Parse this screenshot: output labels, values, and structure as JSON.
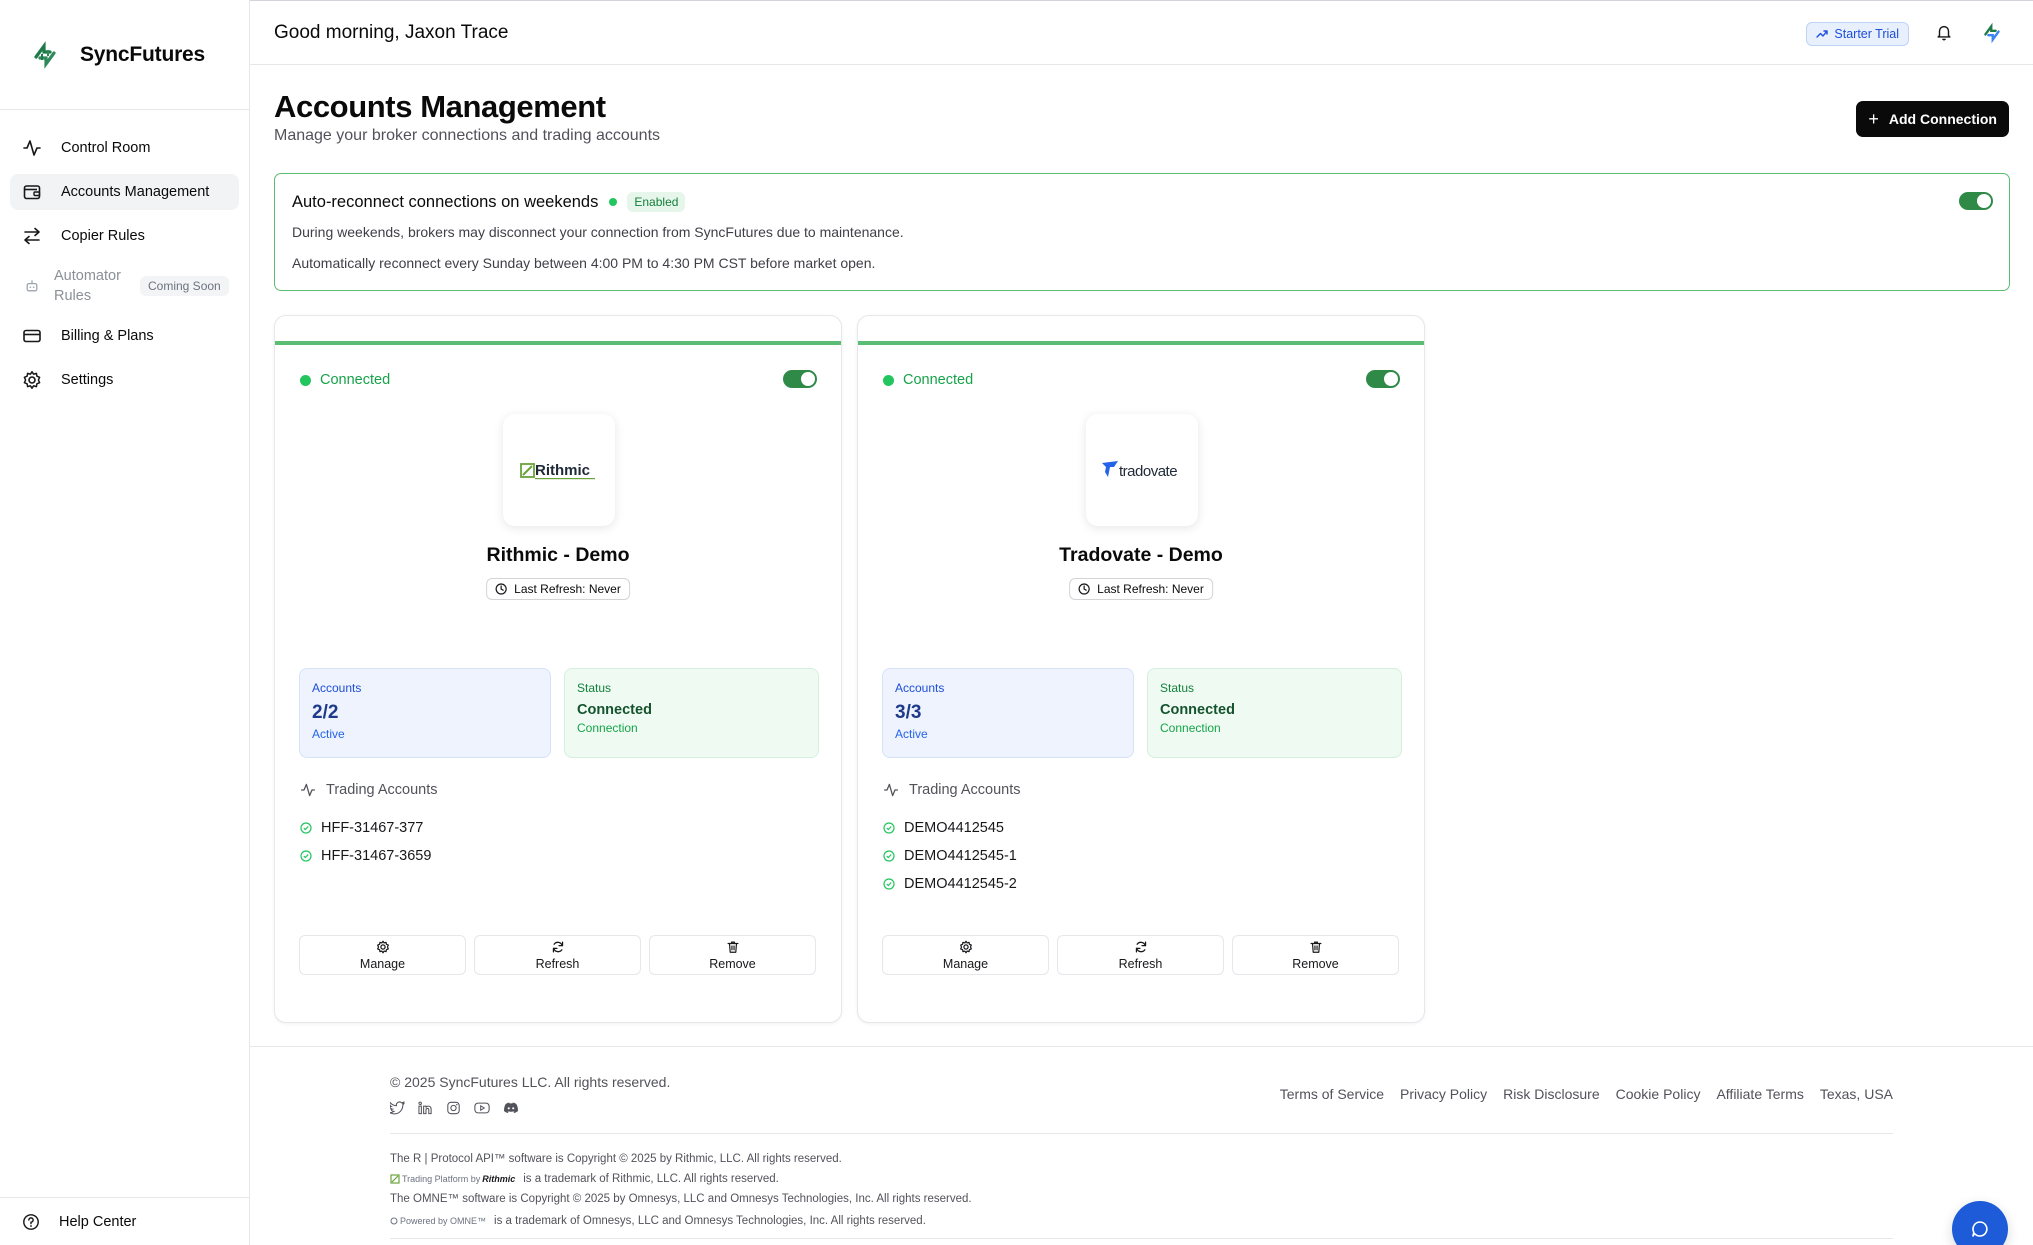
{
  "app": {
    "name": "SyncFutures"
  },
  "header": {
    "greeting": "Good morning, Jaxon Trace",
    "plan_badge": "Starter Trial"
  },
  "sidebar": {
    "items": [
      {
        "label": "Control Room",
        "icon": "activity-icon"
      },
      {
        "label": "Accounts Management",
        "icon": "wallet-icon",
        "active": true
      },
      {
        "label": "Copier Rules",
        "icon": "arrows-swap-icon"
      },
      {
        "label": "Automator Rules",
        "icon": "bot-icon",
        "badge": "Coming Soon",
        "disabled": true
      },
      {
        "label": "Billing & Plans",
        "icon": "credit-card-icon"
      },
      {
        "label": "Settings",
        "icon": "gear-icon"
      }
    ],
    "help": "Help Center"
  },
  "page": {
    "title": "Accounts Management",
    "subtitle": "Manage your broker connections and trading accounts",
    "add_button": "Add Connection"
  },
  "auto_reconnect": {
    "title": "Auto-reconnect connections on weekends",
    "badge": "Enabled",
    "line1": "During weekends, brokers may disconnect your connection from SyncFutures due to maintenance.",
    "line2": "Automatically reconnect every Sunday between 4:00 PM to 4:30 PM CST before market open.",
    "enabled": true
  },
  "connections": [
    {
      "status": "Connected",
      "logo_text": "Rithmic",
      "name": "Rithmic - Demo",
      "last_refresh": "Last Refresh: Never",
      "accounts_label": "Accounts",
      "accounts_value": "2/2",
      "accounts_sub": "Active",
      "status_label": "Status",
      "status_value": "Connected",
      "status_sub": "Connection",
      "trading_accounts_label": "Trading Accounts",
      "trading_accounts": [
        "HFF-31467-377",
        "HFF-31467-3659"
      ],
      "actions": {
        "manage": "Manage",
        "refresh": "Refresh",
        "remove": "Remove"
      }
    },
    {
      "status": "Connected",
      "logo_text": "tradovate",
      "name": "Tradovate - Demo",
      "last_refresh": "Last Refresh: Never",
      "accounts_label": "Accounts",
      "accounts_value": "3/3",
      "accounts_sub": "Active",
      "status_label": "Status",
      "status_value": "Connected",
      "status_sub": "Connection",
      "trading_accounts_label": "Trading Accounts",
      "trading_accounts": [
        "DEMO4412545",
        "DEMO4412545-1",
        "DEMO4412545-2"
      ],
      "actions": {
        "manage": "Manage",
        "refresh": "Refresh",
        "remove": "Remove"
      }
    }
  ],
  "footer": {
    "copyright": "© 2025 SyncFutures LLC. All rights reserved.",
    "links": [
      "Terms of Service",
      "Privacy Policy",
      "Risk Disclosure",
      "Cookie Policy",
      "Affiliate Terms",
      "Texas, USA"
    ],
    "socials": [
      "twitter-icon",
      "linkedin-icon",
      "instagram-icon",
      "youtube-icon",
      "discord-icon"
    ],
    "legal1": "The R | Protocol API™ software is Copyright © 2025 by Rithmic, LLC. All rights reserved.",
    "rithmic_mini_logo": "Trading Platform by",
    "rithmic_mini_logo_brand": "Rithmic",
    "legal2": "is a trademark of Rithmic, LLC. All rights reserved.",
    "legal3": "The OMNE™ software is Copyright © 2025 by Omnesys, LLC and Omnesys Technologies, Inc. All rights reserved.",
    "omne_mini_logo": "Powered by OMNE™",
    "legal4": "is a trademark of Omnesys, LLC and Omnesys Technologies, Inc. All rights reserved."
  },
  "colors": {
    "accent_green": "#22c55e",
    "toggle_green": "#2f8a48",
    "primary_dark": "#0a0a0a",
    "chat_blue": "#1d5bd8"
  }
}
